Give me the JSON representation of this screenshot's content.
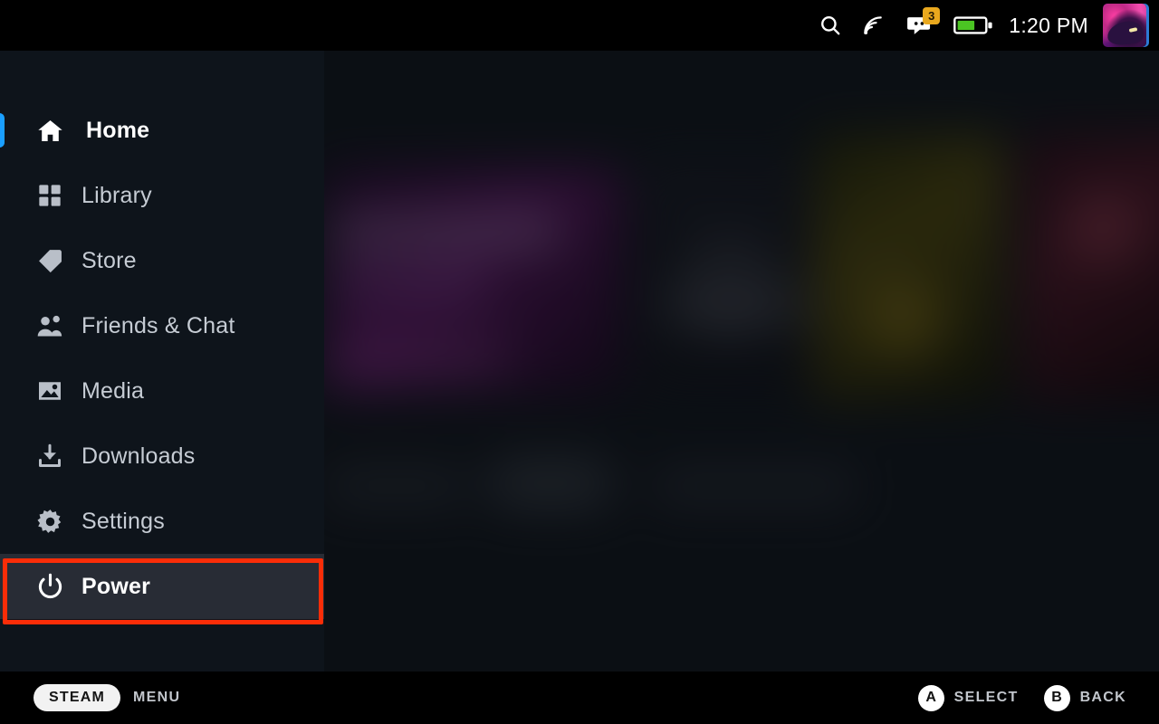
{
  "statusbar": {
    "search_icon": "search-icon",
    "network_icon": "wifi-signal-icon",
    "chat_icon": "chat-bubble-icon",
    "chat_badge_count": "3",
    "battery_icon": "battery-icon",
    "battery_level_pct": 60,
    "clock": "1:20 PM",
    "avatar_icon": "user-avatar"
  },
  "sidebar": {
    "items": [
      {
        "label": "Home",
        "icon": "home-icon",
        "active": true,
        "focused": false
      },
      {
        "label": "Library",
        "icon": "library-icon",
        "active": false,
        "focused": false
      },
      {
        "label": "Store",
        "icon": "store-tag-icon",
        "active": false,
        "focused": false
      },
      {
        "label": "Friends & Chat",
        "icon": "friends-icon",
        "active": false,
        "focused": false
      },
      {
        "label": "Media",
        "icon": "media-icon",
        "active": false,
        "focused": false
      },
      {
        "label": "Downloads",
        "icon": "download-icon",
        "active": false,
        "focused": false
      },
      {
        "label": "Settings",
        "icon": "gear-icon",
        "active": false,
        "focused": false
      },
      {
        "label": "Power",
        "icon": "power-icon",
        "active": false,
        "focused": true
      }
    ]
  },
  "annotation": {
    "target": "Power",
    "color": "#fa2d08"
  },
  "bottombar": {
    "steam_label": "STEAM",
    "menu_label": "MENU",
    "select_button": "A",
    "select_label": "SELECT",
    "back_button": "B",
    "back_label": "BACK"
  },
  "colors": {
    "accent_blue": "#1a9fff",
    "sidebar_bg": "#0e141b",
    "focus_bg": "#282c35",
    "badge_amber": "#e9a81e",
    "battery_green": "#4bc523",
    "annotation_red": "#fa2d08"
  }
}
